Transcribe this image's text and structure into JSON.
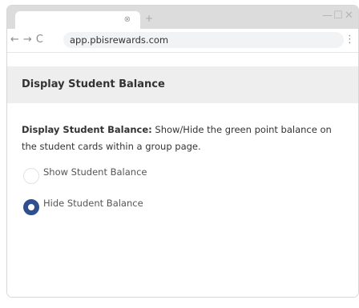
{
  "browser": {
    "tab_close": "⊗",
    "new_tab": "+",
    "controls": {
      "minimize": "—",
      "maximize": "☐",
      "close": "✕"
    },
    "nav": {
      "back": "←",
      "forward": "→",
      "reload": "C"
    },
    "url": "app.pbisrewards.com",
    "menu": "⋮"
  },
  "section": {
    "title": "Display Student Balance"
  },
  "setting": {
    "label": "Display Student Balance:",
    "description": " Show/Hide the green point balance on the student cards within a group page."
  },
  "options": [
    {
      "label": "Show Student Balance",
      "selected": false
    },
    {
      "label": "Hide Student Balance",
      "selected": true
    }
  ],
  "colors": {
    "accent": "#2f4f8f",
    "header_bg": "#eeeeee",
    "tabbar_bg": "#dcdcdc"
  }
}
